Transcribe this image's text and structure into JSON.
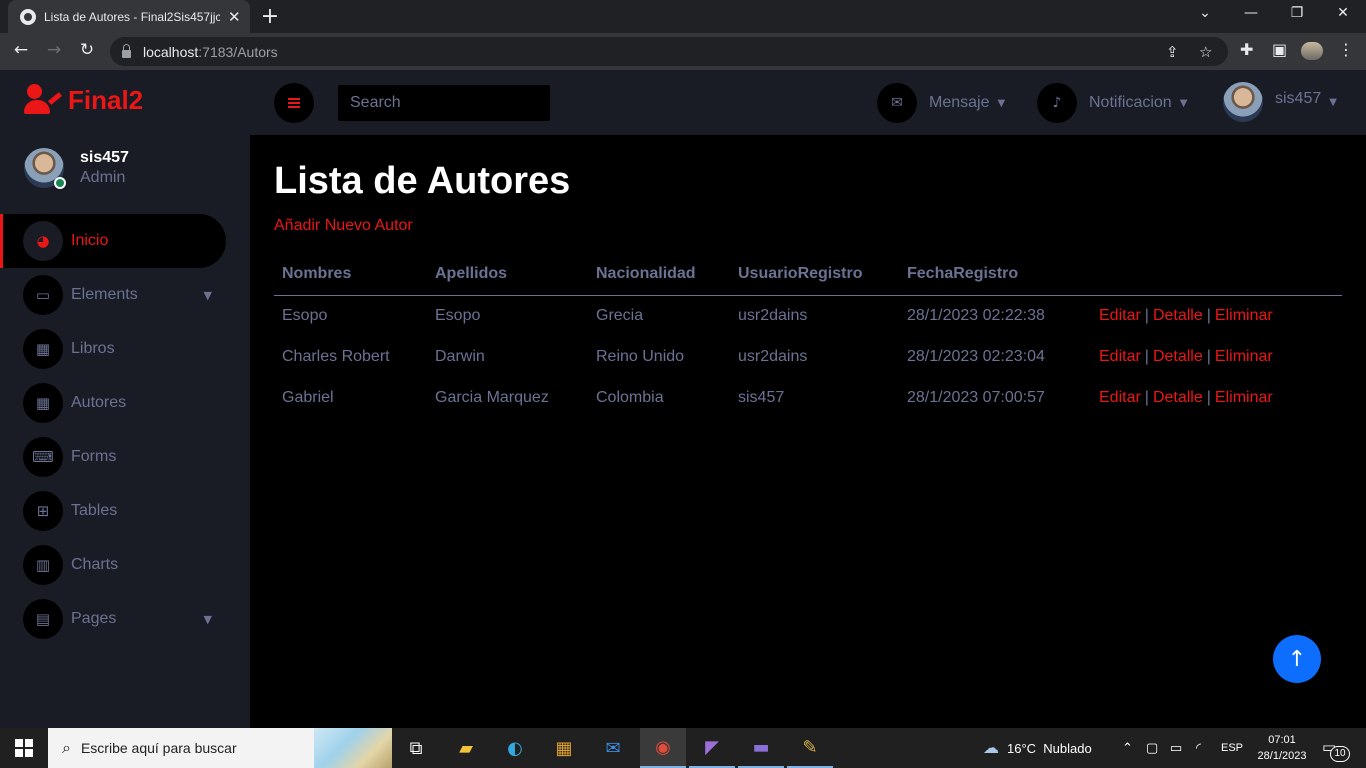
{
  "browser": {
    "tab_title": "Lista de Autores - Final2Sis457jjc",
    "new_tab_icon": "+",
    "url_host": "localhost",
    "url_path": ":7183/Autors"
  },
  "sidebar": {
    "brand": "Final2",
    "user_name": "sis457",
    "user_role": "Admin",
    "items": [
      {
        "label": "Inicio",
        "icon": "tachometer-icon",
        "active": true
      },
      {
        "label": "Elements",
        "icon": "laptop-icon",
        "has_caret": true
      },
      {
        "label": "Libros",
        "icon": "grid-icon"
      },
      {
        "label": "Autores",
        "icon": "grid-icon"
      },
      {
        "label": "Forms",
        "icon": "keyboard-icon"
      },
      {
        "label": "Tables",
        "icon": "table-icon"
      },
      {
        "label": "Charts",
        "icon": "chart-bar-icon"
      },
      {
        "label": "Pages",
        "icon": "file-icon",
        "has_caret": true
      }
    ]
  },
  "topbar": {
    "search_placeholder": "Search",
    "message_label": "Mensaje",
    "notification_label": "Notificacion",
    "user_label": "sis457"
  },
  "main": {
    "title": "Lista de Autores",
    "add_link": "Añadir Nuevo Autor",
    "columns": [
      "Nombres",
      "Apellidos",
      "Nacionalidad",
      "UsuarioRegistro",
      "FechaRegistro"
    ],
    "rows": [
      {
        "nombres": "Esopo",
        "apellidos": "Esopo",
        "nacionalidad": "Grecia",
        "usuario": "usr2dains",
        "fecha": "28/1/2023 02:22:38"
      },
      {
        "nombres": "Charles Robert",
        "apellidos": "Darwin",
        "nacionalidad": "Reino Unido",
        "usuario": "usr2dains",
        "fecha": "28/1/2023 02:23:04"
      },
      {
        "nombres": "Gabriel",
        "apellidos": "Garcia Marquez",
        "nacionalidad": "Colombia",
        "usuario": "sis457",
        "fecha": "28/1/2023 07:00:57"
      }
    ],
    "actions": {
      "edit": "Editar",
      "detail": "Detalle",
      "delete": "Eliminar",
      "separator": "|"
    }
  },
  "taskbar": {
    "search_text": "Escribe aquí para buscar",
    "weather": "16°C  Nublado",
    "language": "ESP",
    "time": "07:01",
    "date": "28/1/2023",
    "notification_count": "10"
  },
  "colors": {
    "accent": "#eb1616",
    "sidebar_bg": "#191c24",
    "text_muted": "#6c7293",
    "scroll_button": "#0d6efd"
  }
}
